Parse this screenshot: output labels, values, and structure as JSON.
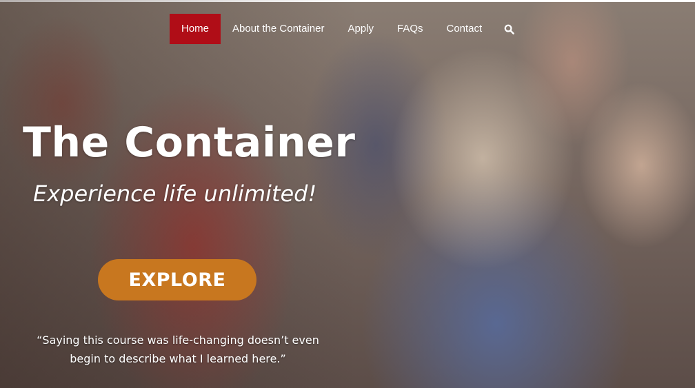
{
  "nav": {
    "items": [
      {
        "label": "Home",
        "active": true
      },
      {
        "label": "About the Container",
        "active": false
      },
      {
        "label": "Apply",
        "active": false
      },
      {
        "label": "FAQs",
        "active": false
      },
      {
        "label": "Contact",
        "active": false
      }
    ],
    "search_icon": "search-icon"
  },
  "hero": {
    "title": "The Container",
    "tagline": "Experience life unlimited!",
    "cta_label": "EXPLORE",
    "quote": "“Saying this course was life-changing doesn’t even begin to describe what I learned here.”"
  },
  "colors": {
    "nav_active": "#b00d17",
    "cta_button": "#c8771f",
    "text": "#ffffff"
  }
}
